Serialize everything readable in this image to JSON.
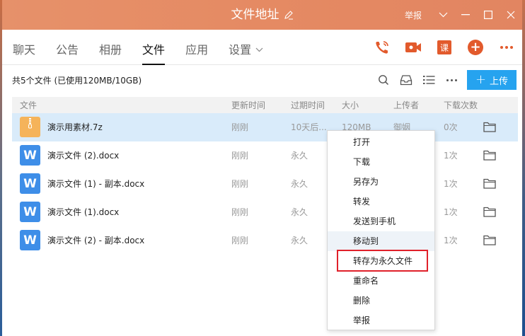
{
  "window": {
    "title": "文件地址",
    "report_label": "举报"
  },
  "tabs": [
    {
      "label": "聊天"
    },
    {
      "label": "公告"
    },
    {
      "label": "相册"
    },
    {
      "label": "文件",
      "active": true
    },
    {
      "label": "应用"
    },
    {
      "label": "设置"
    }
  ],
  "tab_icons": {
    "ke_label": "课"
  },
  "toolbar": {
    "summary": "共5个文件 (已使用120MB/10GB)",
    "upload_label": "上传"
  },
  "table": {
    "headers": {
      "name": "文件",
      "updated": "更新时间",
      "expires": "过期时间",
      "size": "大小",
      "uploader": "上传者",
      "downloads": "下载次数"
    },
    "rows": [
      {
        "name": "演示用素材.7z",
        "updated": "刚刚",
        "expires": "10天后...",
        "size": "120MB",
        "uploader": "御姻",
        "downloads": "0次",
        "type": "zip"
      },
      {
        "name": "演示文件 (2).docx",
        "updated": "刚刚",
        "expires": "永久",
        "downloads": "1次",
        "type": "word"
      },
      {
        "name": "演示文件 (1) - 副本.docx",
        "updated": "刚刚",
        "expires": "永久",
        "downloads": "1次",
        "type": "word"
      },
      {
        "name": "演示文件 (1).docx",
        "updated": "刚刚",
        "expires": "永久",
        "downloads": "1次",
        "type": "word"
      },
      {
        "name": "演示文件 (2) - 副本.docx",
        "updated": "刚刚",
        "expires": "永久",
        "downloads": "1次",
        "type": "word"
      }
    ],
    "file_icon_letter": "W"
  },
  "context_menu": {
    "items": [
      {
        "label": "打开"
      },
      {
        "label": "下载"
      },
      {
        "label": "另存为"
      },
      {
        "label": "转发"
      },
      {
        "label": "发送到手机"
      },
      {
        "label": "移动到"
      },
      {
        "label": "转存为永久文件"
      },
      {
        "label": "重命名"
      },
      {
        "label": "删除"
      },
      {
        "label": "举报"
      }
    ]
  },
  "colors": {
    "title_bar": "#e58a63",
    "accent": "#e25a2c",
    "upload_button": "#26a3ef",
    "selected_row": "#d9ebfa",
    "highlight_box": "#e0202a"
  }
}
